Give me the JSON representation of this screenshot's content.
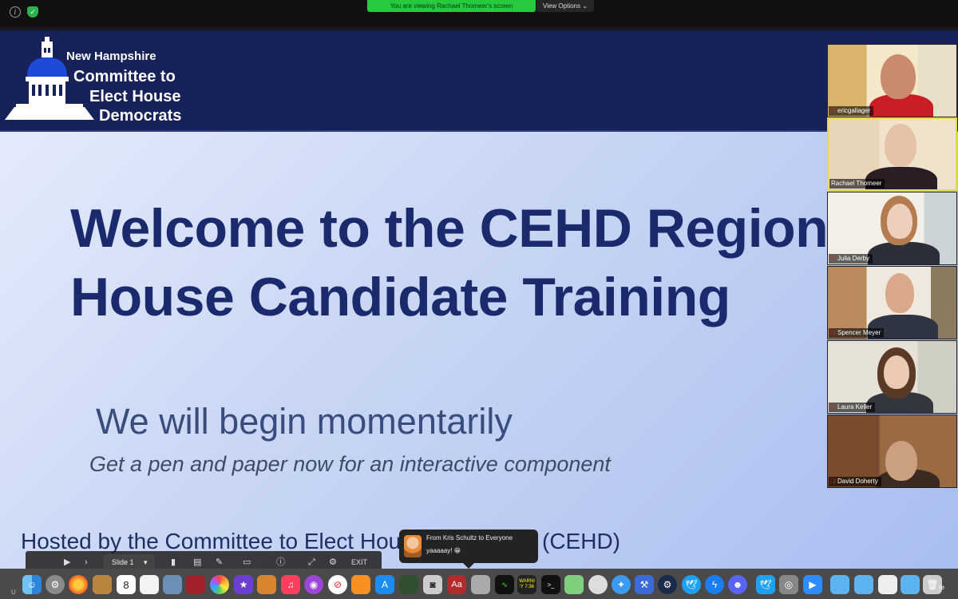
{
  "topbar": {
    "viewing_banner": "You are viewing Rachael Thomeer's screen",
    "view_options": "View Options"
  },
  "slide": {
    "org_line1": "New Hampshire",
    "org_line2": "Committee to",
    "org_line3": "Elect House",
    "org_line4": "Democrats",
    "title": "Welcome to the CEHD Region\nHouse Candidate Training",
    "subtitle": "We will begin momentarily",
    "instruction": "Get a pen and paper now for an interactive component",
    "hosted": "Hosted by the Committee to Elect Hou",
    "hosted_end": "(CEHD)"
  },
  "slide_controls": {
    "slide_label": "Slide 1",
    "exit_label": "EXIT"
  },
  "chat": {
    "from": "From Kris Schultz to Everyone",
    "message": "yaaaaay! 😁"
  },
  "participants": [
    {
      "name": "ericgallager",
      "muted": true
    },
    {
      "name": "Rachael Thomeer",
      "muted": false,
      "active": true
    },
    {
      "name": "Julia Derby",
      "muted": true
    },
    {
      "name": "Spencer Meyer",
      "muted": true
    },
    {
      "name": "Laura Keller",
      "muted": true
    },
    {
      "name": "David Doherty",
      "muted": true
    }
  ],
  "dock": {
    "left_text": "U",
    "right_text": "re",
    "calendar_day": "8",
    "console_text": "WARNI\n:Y 7:36",
    "items": [
      "finder-icon",
      "system-preferences-icon",
      "firefox-icon",
      "notes-app-icon",
      "calendar-icon",
      "textedit-icon",
      "preview-icon",
      "photo-booth-icon",
      "photos-icon",
      "imovie-icon",
      "garageband-icon",
      "music-icon",
      "podcasts-icon",
      "news-icon",
      "books-icon",
      "app-store-icon",
      "mission-control-icon",
      "screenshot-icon",
      "dictionary-icon",
      "font-book-icon",
      "activity-monitor-icon",
      "console-icon",
      "terminal-icon",
      "maps-icon",
      "disk-utility-icon",
      "safari-icon",
      "xcode-icon",
      "steam-icon",
      "twitter-icon",
      "messenger-icon",
      "discord-icon",
      "twitter-alt-icon",
      "disk-drive-icon",
      "zoom-icon",
      "folder-icon",
      "folder-2-icon",
      "document-icon",
      "downloads-folder-icon",
      "trash-icon"
    ]
  }
}
